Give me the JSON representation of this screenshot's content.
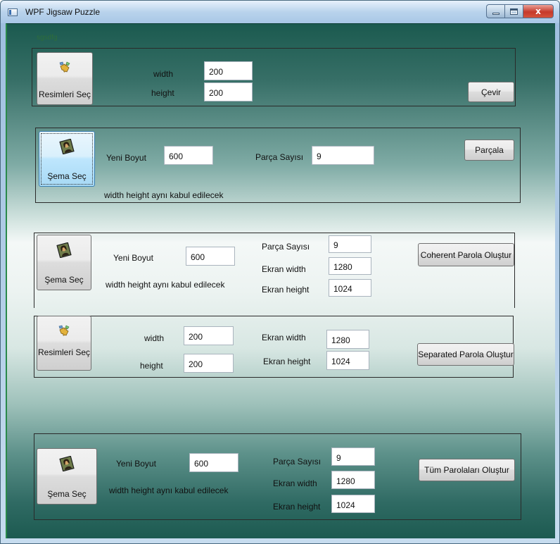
{
  "window": {
    "title": "WPF Jigsaw Puzzle",
    "controls": {
      "minimize": "minimize",
      "maximize": "maximize",
      "close": "x"
    }
  },
  "client_label": "sgsdfg",
  "panel1": {
    "button_label": "Resimleri Seç",
    "button_icon": "puzzle-icon",
    "width_label": "width",
    "width_value": "200",
    "height_label": "height",
    "height_value": "200",
    "action_label": "Çevir"
  },
  "panel2": {
    "button_label": "Şema Seç",
    "button_icon": "mona-lisa-icon",
    "size_label": "Yeni Boyut",
    "size_value": "600",
    "count_label": "Parça Sayısı",
    "count_value": "9",
    "action_label": "Parçala",
    "note": "width height aynı kabul edilecek"
  },
  "panel3": {
    "button_label": "Şema Seç",
    "button_icon": "mona-lisa-icon",
    "size_label": "Yeni Boyut",
    "size_value": "600",
    "note": "width height aynı kabul edilecek",
    "count_label": "Parça Sayısı",
    "count_value": "9",
    "screen_width_label": "Ekran width",
    "screen_width_value": "1280",
    "screen_height_label": "Ekran height",
    "screen_height_value": "1024",
    "action_label": "Coherent Parola Oluştur"
  },
  "panel4": {
    "button_label": "Resimleri Seç",
    "button_icon": "puzzle-icon",
    "width_label": "width",
    "width_value": "200",
    "height_label": "height",
    "height_value": "200",
    "screen_width_label": "Ekran width",
    "screen_width_value": "1280",
    "screen_height_label": "Ekran height",
    "screen_height_value": "1024",
    "action_label": "Separated Parola Oluştur"
  },
  "panel5": {
    "button_label": "Şema Seç",
    "button_icon": "mona-lisa-icon",
    "size_label": "Yeni Boyut",
    "size_value": "600",
    "note": "width height aynı kabul edilecek",
    "count_label": "Parça Sayısı",
    "count_value": "9",
    "screen_width_label": "Ekran width",
    "screen_width_value": "1280",
    "screen_height_label": "Ekran height",
    "screen_height_value": "1024",
    "action_label": "Tüm Parolaları Oluştur"
  }
}
